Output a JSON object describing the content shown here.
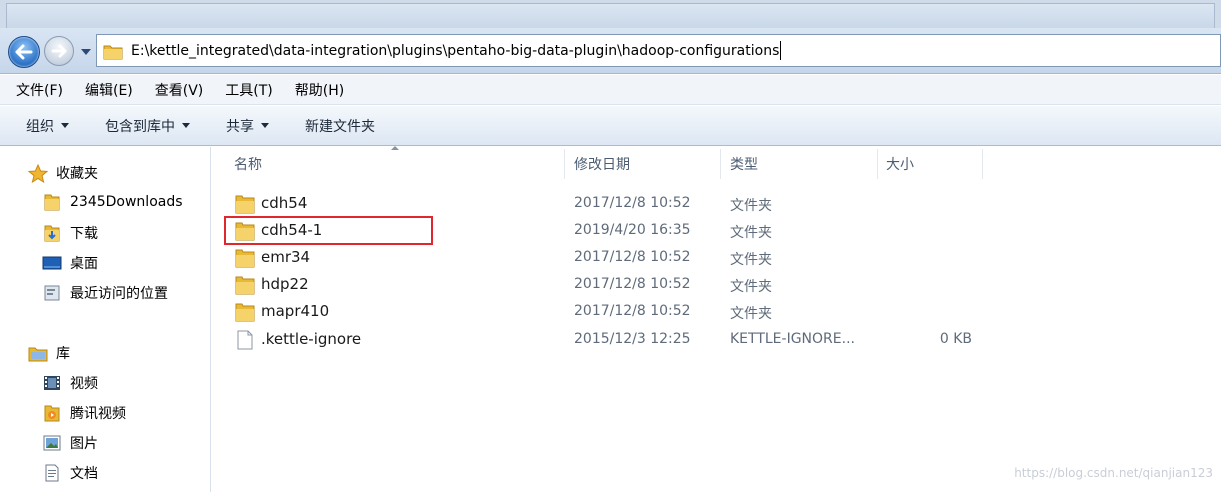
{
  "address": {
    "path": "E:\\kettle_integrated\\data-integration\\plugins\\pentaho-big-data-plugin\\hadoop-configurations"
  },
  "menu": [
    {
      "label": "文件(F)"
    },
    {
      "label": "编辑(E)"
    },
    {
      "label": "查看(V)"
    },
    {
      "label": "工具(T)"
    },
    {
      "label": "帮助(H)"
    }
  ],
  "commands": [
    {
      "label": "组织"
    },
    {
      "label": "包含到库中"
    },
    {
      "label": "共享"
    },
    {
      "label": "新建文件夹"
    }
  ],
  "sidebar": {
    "favorites": {
      "label": "收藏夹",
      "icon": "star-icon"
    },
    "favorite_items": [
      {
        "label": "2345Downloads",
        "icon": "folder-icon"
      },
      {
        "label": "下载",
        "icon": "downloads-folder-icon"
      },
      {
        "label": "桌面",
        "icon": "desktop-icon"
      },
      {
        "label": "最近访问的位置",
        "icon": "recent-places-icon"
      }
    ],
    "libraries": {
      "label": "库",
      "icon": "library-icon"
    },
    "library_items": [
      {
        "label": "视频",
        "icon": "video-icon"
      },
      {
        "label": "腾讯视频",
        "icon": "tencent-video-icon"
      },
      {
        "label": "图片",
        "icon": "pictures-icon"
      },
      {
        "label": "文档",
        "icon": "documents-icon"
      }
    ]
  },
  "columns": {
    "name": "名称",
    "modified": "修改日期",
    "type": "类型",
    "size": "大小"
  },
  "files": [
    {
      "name": "cdh54",
      "modified": "2017/12/8 10:52",
      "type": "文件夹",
      "size": "",
      "icon": "folder-icon"
    },
    {
      "name": "cdh54-1",
      "modified": "2019/4/20 16:35",
      "type": "文件夹",
      "size": "",
      "icon": "folder-icon",
      "highlighted": true
    },
    {
      "name": "emr34",
      "modified": "2017/12/8 10:52",
      "type": "文件夹",
      "size": "",
      "icon": "folder-icon"
    },
    {
      "name": "hdp22",
      "modified": "2017/12/8 10:52",
      "type": "文件夹",
      "size": "",
      "icon": "folder-icon"
    },
    {
      "name": "mapr410",
      "modified": "2017/12/8 10:52",
      "type": "文件夹",
      "size": "",
      "icon": "folder-icon"
    },
    {
      "name": ".kettle-ignore",
      "modified": "2015/12/3 12:25",
      "type": "KETTLE-IGNORE...",
      "size": "0 KB",
      "icon": "file-icon"
    }
  ],
  "watermark": "https://blog.csdn.net/qianjian123",
  "colors": {
    "highlight": "#e0272d",
    "folder": "#e8b934",
    "nav_bar": "#cfdbe9"
  }
}
